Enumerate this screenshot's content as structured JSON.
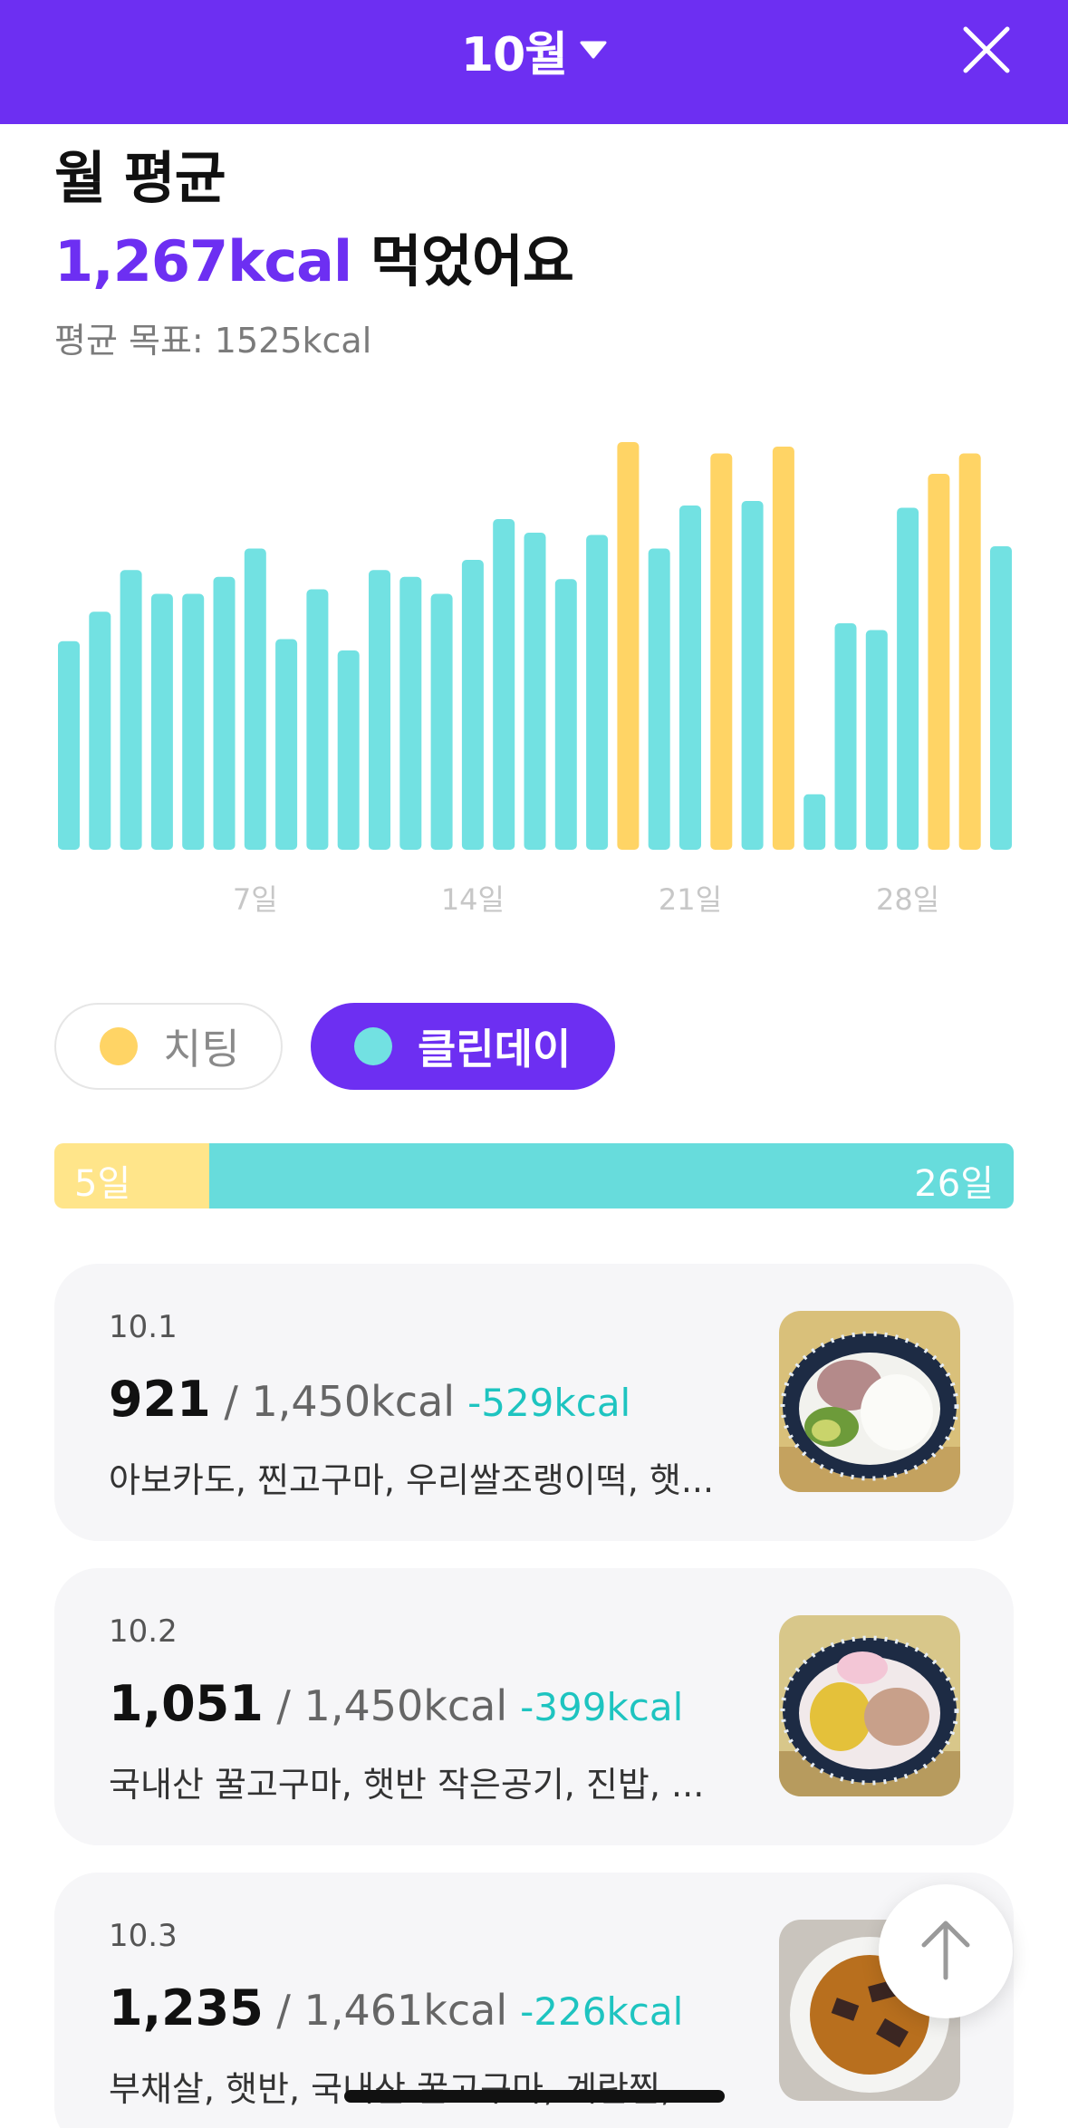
{
  "header": {
    "month": "10월",
    "close_icon": "close-icon",
    "dropdown_icon": "caret-down-icon"
  },
  "summary": {
    "title": "월 평균",
    "avg_kcal": "1,267kcal",
    "suffix": " 먹었어요",
    "goal": "평균 목표: 1525kcal"
  },
  "colors": {
    "accent": "#6d2ff2",
    "cheat": "#ffd465",
    "clean": "#72e1e2",
    "diff": "#1ec4c0"
  },
  "chart_data": {
    "type": "bar",
    "categories": [
      "1",
      "2",
      "3",
      "4",
      "5",
      "6",
      "7",
      "8",
      "9",
      "10",
      "11",
      "12",
      "13",
      "14",
      "15",
      "16",
      "17",
      "18",
      "19",
      "20",
      "21",
      "22",
      "23",
      "24",
      "25",
      "26",
      "27",
      "28",
      "29",
      "30",
      "31"
    ],
    "values": [
      921,
      1051,
      1235,
      1130,
      1130,
      1205,
      1330,
      930,
      1150,
      880,
      1235,
      1205,
      1130,
      1280,
      1460,
      1400,
      1195,
      1390,
      1800,
      1330,
      1520,
      1750,
      1540,
      1780,
      245,
      1000,
      970,
      1510,
      1660,
      1750,
      1340
    ],
    "day_types": [
      "clean",
      "clean",
      "clean",
      "clean",
      "clean",
      "clean",
      "clean",
      "clean",
      "clean",
      "clean",
      "clean",
      "clean",
      "clean",
      "clean",
      "clean",
      "clean",
      "clean",
      "clean",
      "cheat",
      "clean",
      "clean",
      "cheat",
      "clean",
      "cheat",
      "clean",
      "clean",
      "clean",
      "clean",
      "cheat",
      "cheat",
      "clean"
    ],
    "x_tick_labels": [
      {
        "index": 6,
        "label": "7일"
      },
      {
        "index": 13,
        "label": "14일"
      },
      {
        "index": 20,
        "label": "21일"
      },
      {
        "index": 27,
        "label": "28일"
      }
    ],
    "ylim": [
      0,
      1800
    ],
    "grid": false
  },
  "legend": {
    "cheat": "치팅",
    "clean": "클린데이"
  },
  "ratio": {
    "cheat_days": 5,
    "clean_days": 26,
    "cheat_label": "5일",
    "clean_label": "26일"
  },
  "days": [
    {
      "date": "10.1",
      "eaten": "921",
      "target": " / 1,450kcal",
      "diff": "-529kcal",
      "foods": "아보카도, 찐고구마, 우리쌀조랭이떡, 햇..."
    },
    {
      "date": "10.2",
      "eaten": "1,051",
      "target": " / 1,450kcal",
      "diff": "-399kcal",
      "foods": "국내산 꿀고구마, 햇반 작은공기, 진밥, ..."
    },
    {
      "date": "10.3",
      "eaten": "1,235",
      "target": " / 1,461kcal",
      "diff": "-226kcal",
      "foods": "부채살, 햇반, 국내산 꿀고구마, 계란찜, ..."
    }
  ],
  "scroll_top_icon": "arrow-up-icon"
}
